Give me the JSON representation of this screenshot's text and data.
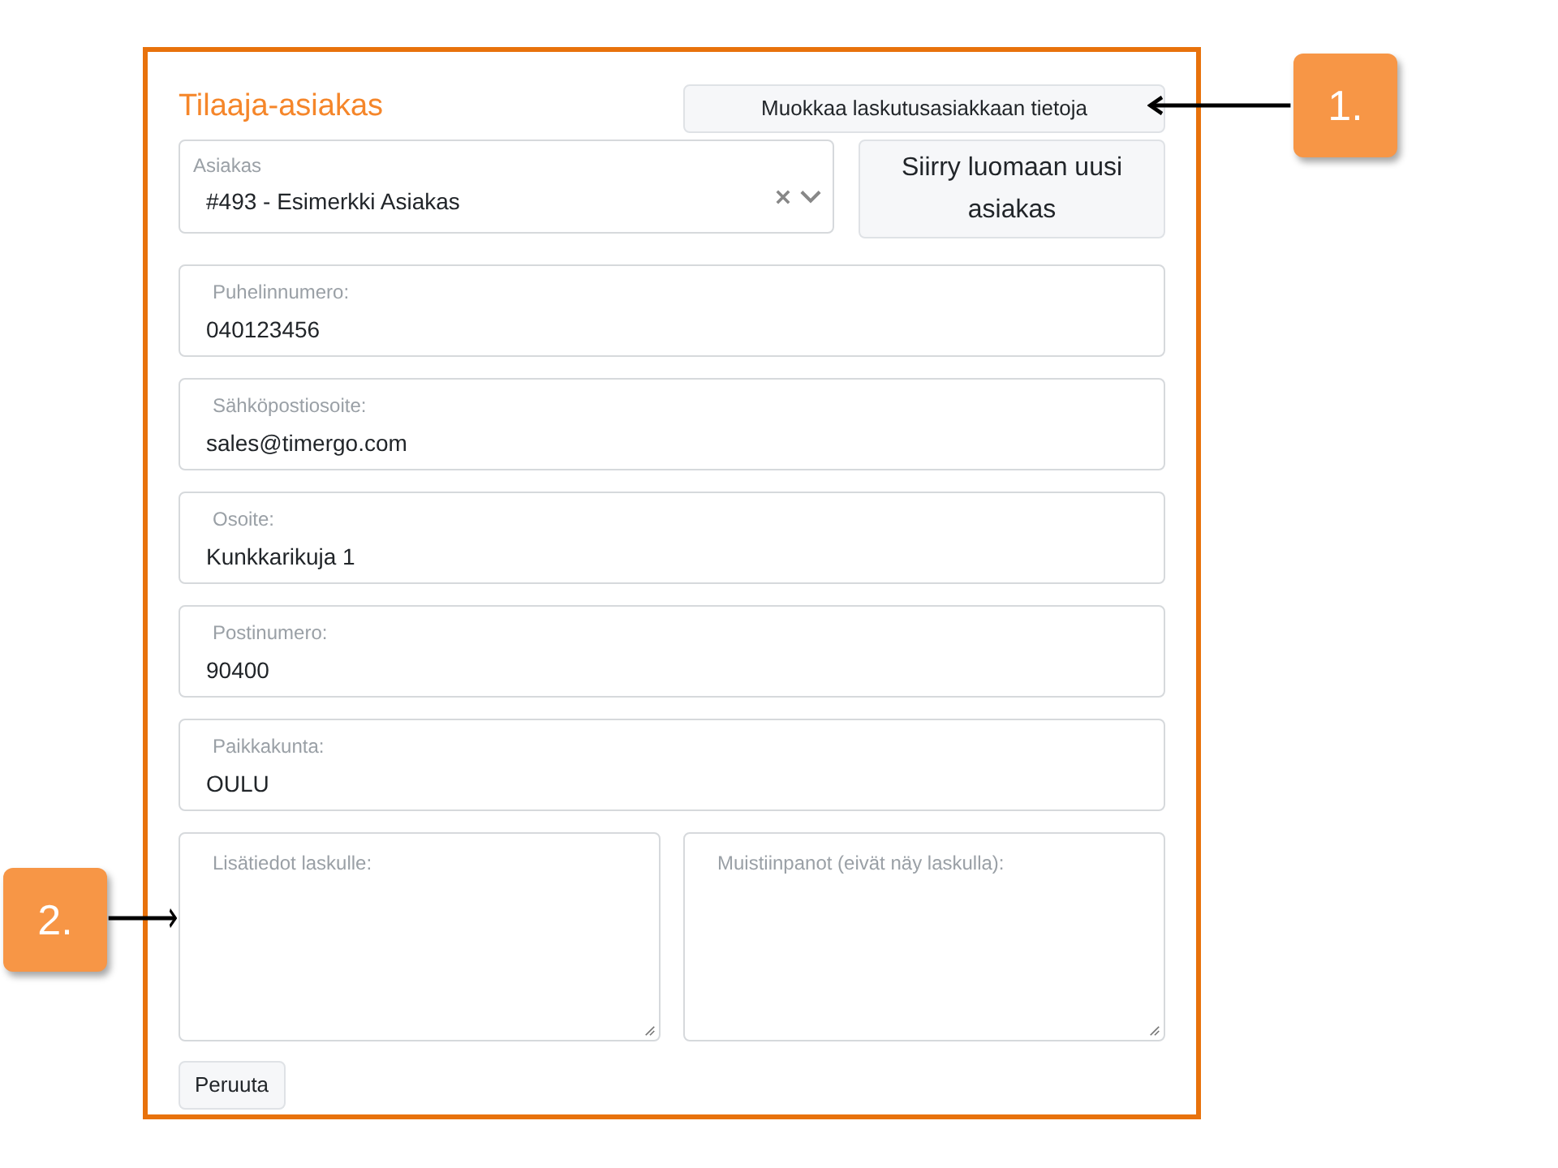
{
  "section_title": "Tilaaja-asiakas",
  "edit_button": "Muokkaa laskutusasiakkaan tietoja",
  "customer_select": {
    "label": "Asiakas",
    "value": "#493 - Esimerkki Asiakas"
  },
  "new_customer_button": "Siirry luomaan uusi asiakas",
  "fields": [
    {
      "label": "Puhelinnumero:",
      "value": "040123456"
    },
    {
      "label": "Sähköpostiosoite:",
      "value": "sales@timergo.com"
    },
    {
      "label": "Osoite:",
      "value": "Kunkkarikuja 1"
    },
    {
      "label": "Postinumero:",
      "value": "90400"
    },
    {
      "label": "Paikkakunta:",
      "value": "OULU"
    }
  ],
  "textareas": [
    {
      "label": "Lisätiedot laskulle:"
    },
    {
      "label": "Muistiinpanot (eivät näy laskulla):"
    }
  ],
  "cancel_button": "Peruuta",
  "callouts": [
    {
      "label": "1."
    },
    {
      "label": "2."
    }
  ]
}
